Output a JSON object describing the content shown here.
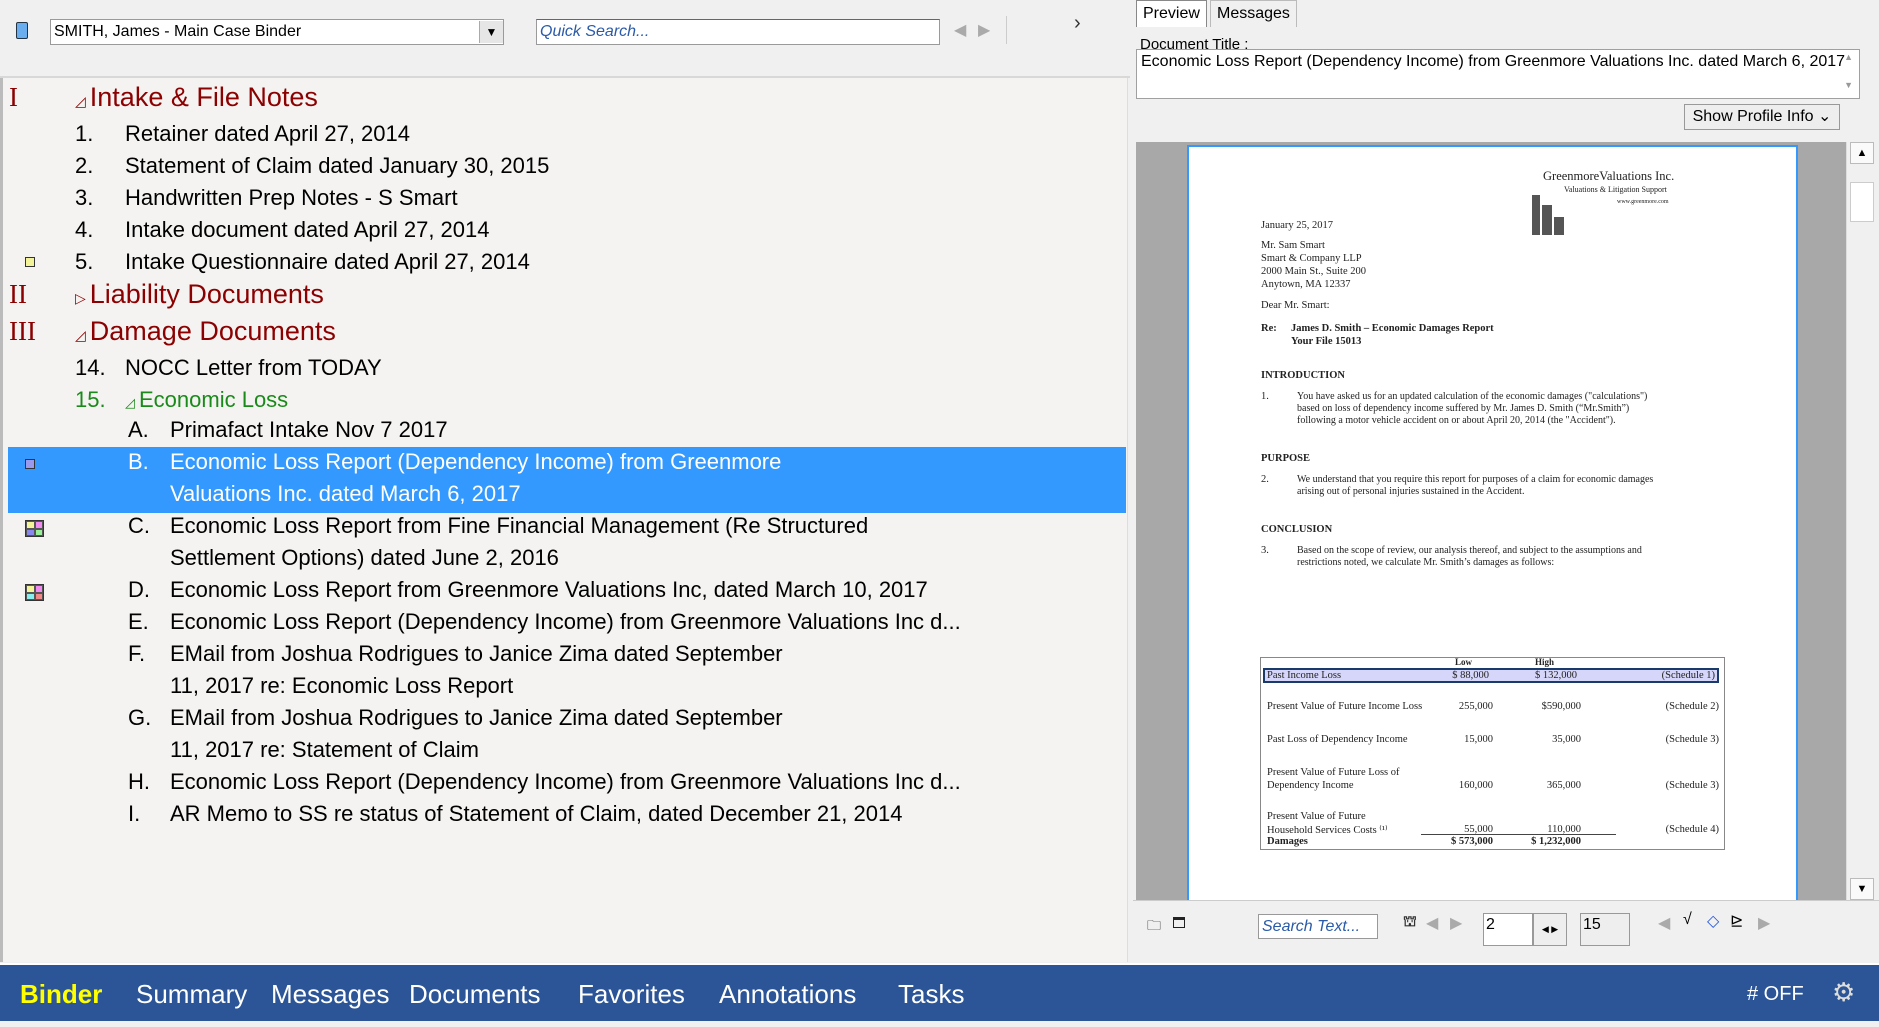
{
  "toolbar": {
    "binder_value": "SMITH, James - Main Case Binder",
    "quick_search_placeholder": "Quick Search..."
  },
  "tree": [
    {
      "kind": "section",
      "roman": "I",
      "toggle": "expanded",
      "label": "Intake & File Notes"
    },
    {
      "kind": "item",
      "num": "1.",
      "label": "Retainer dated April 27, 2014"
    },
    {
      "kind": "item",
      "num": "2.",
      "label": "Statement of Claim dated January 30, 2015"
    },
    {
      "kind": "item",
      "num": "3.",
      "label": "Handwritten Prep Notes - S Smart"
    },
    {
      "kind": "item",
      "num": "4.",
      "label": "Intake document dated April 27, 2014"
    },
    {
      "kind": "item",
      "num": "5.",
      "label": "Intake Questionnaire dated April 27, 2014",
      "marker": "#f3f39a"
    },
    {
      "kind": "section",
      "roman": "II",
      "toggle": "collapsed",
      "label": "Liability Documents"
    },
    {
      "kind": "section",
      "roman": "III",
      "toggle": "expanded",
      "label": "Damage Documents"
    },
    {
      "kind": "item",
      "num": "14.",
      "label": "NOCC Letter from TODAY"
    },
    {
      "kind": "folder",
      "num": "15.",
      "toggle": "expanded",
      "label": "Economic Loss"
    },
    {
      "kind": "sub",
      "num": "A.",
      "lines": [
        "Primafact Intake  Nov 7 2017"
      ]
    },
    {
      "kind": "sub",
      "num": "B.",
      "lines": [
        "Economic Loss Report (Dependency Income) from Greenmore",
        "Valuations Inc. dated March 6, 2017"
      ],
      "selected": true,
      "marker": "#9999ee"
    },
    {
      "kind": "sub",
      "num": "C.",
      "lines": [
        "Economic Loss Report from Fine Financial Management (Re Structured",
        "Settlement Options) dated June 2, 2016"
      ],
      "grid": [
        "#f3f39a",
        "#f08cf0",
        "#8888ee",
        "#99ee99"
      ]
    },
    {
      "kind": "sub",
      "num": "D.",
      "lines": [
        "Economic Loss Report from Greenmore Valuations Inc, dated March 10, 2017"
      ],
      "grid": [
        "#f3f39a",
        "#f08cf0",
        "#88eeee",
        "#f08888"
      ]
    },
    {
      "kind": "sub",
      "num": "E.",
      "lines": [
        "Economic Loss Report (Dependency Income) from Greenmore Valuations Inc d..."
      ]
    },
    {
      "kind": "sub",
      "num": "F.",
      "lines": [
        "EMail from Joshua Rodrigues to Janice Zima dated September",
        "11, 2017 re: Economic Loss Report"
      ]
    },
    {
      "kind": "sub",
      "num": "G.",
      "lines": [
        "EMail from Joshua Rodrigues to Janice Zima dated September",
        "11, 2017 re: Statement of Claim"
      ]
    },
    {
      "kind": "sub",
      "num": "H.",
      "lines": [
        "Economic Loss Report (Dependency Income) from Greenmore Valuations Inc d..."
      ]
    },
    {
      "kind": "sub",
      "num": "I.",
      "lines": [
        "AR Memo to SS re status of Statement of Claim, dated December 21, 2014"
      ]
    }
  ],
  "right": {
    "tabs": [
      "Preview",
      "Messages"
    ],
    "doc_title_label": "Document Title :",
    "doc_title": "Economic Loss Report (Dependency Income) from Greenmore Valuations Inc. dated March 6, 2017",
    "profile_button": "Show Profile Info ⌄"
  },
  "document": {
    "logo_name": "GreenmoreValuations Inc.",
    "logo_tagline": "Valuations & Litigation Support",
    "logo_url": "www.greenmore.com",
    "date": "January 25, 2017",
    "address": [
      "Mr. Sam Smart",
      "Smart & Company LLP",
      "2000 Main St., Suite 200",
      "Anytown, MA 12337"
    ],
    "salutation": "Dear Mr. Smart:",
    "re_label": "Re:",
    "re_lines": [
      "James D. Smith – Economic Damages Report",
      "Your File 15013"
    ],
    "sections": [
      {
        "heading": "INTRODUCTION",
        "num": "1.",
        "lines": [
          "You have asked us for an updated calculation of the economic damages (\"calculations\")",
          "based on loss of dependency income suffered by Mr. James D. Smith (“Mr.Smith”)",
          "following a motor vehicle accident on or about April 20, 2014 (the \"Accident\")."
        ]
      },
      {
        "heading": "PURPOSE",
        "num": "2.",
        "lines": [
          "We understand that you require this report for purposes of a claim for economic damages",
          "arising out of personal injuries sustained in the Accident."
        ]
      },
      {
        "heading": "CONCLUSION",
        "num": "3.",
        "lines": [
          "Based on the scope of review, our analysis thereof, and subject to the assumptions and",
          "restrictions noted, we calculate Mr. Smith’s damages as follows:"
        ]
      }
    ],
    "table": {
      "headers": [
        "Low",
        "High"
      ],
      "rows": [
        {
          "label": [
            "Past Income Loss"
          ],
          "low": "$  88,000",
          "high": "$ 132,000",
          "ref": "(Schedule 1)"
        },
        {
          "label": [
            "Present Value of Future Income Loss"
          ],
          "low": "255,000",
          "high": "$590,000",
          "ref": "(Schedule 2)"
        },
        {
          "label": [
            "Past Loss of Dependency Income"
          ],
          "low": "15,000",
          "high": "35,000",
          "ref": "(Schedule 3)"
        },
        {
          "label": [
            "Present Value of Future Loss of",
            "Dependency Income"
          ],
          "low": "160,000",
          "high": "365,000",
          "ref": "(Schedule 3)"
        },
        {
          "label": [
            "Present Value of Future",
            "Household Services Costs ⁽¹⁾"
          ],
          "low": "55,000",
          "high": "110,000",
          "ref": "(Schedule 4)"
        }
      ],
      "total": {
        "label": "Damages",
        "low": "$ 573,000",
        "high": "$ 1,232,000"
      }
    }
  },
  "viewer_toolbar": {
    "search_placeholder": "Search Text...",
    "page": "2",
    "total_pages": "15"
  },
  "footer": {
    "tabs": [
      "Binder",
      "Summary",
      "Messages",
      "Documents",
      "Favorites",
      "Annotations",
      "Tasks"
    ],
    "active": "Binder",
    "hash_toggle": "# OFF"
  },
  "colors": {
    "section": "#8b0000",
    "folder": "#1a8a1a",
    "selection": "#3399ff",
    "footer": "#2b5597",
    "active_tab": "#ffff00"
  }
}
